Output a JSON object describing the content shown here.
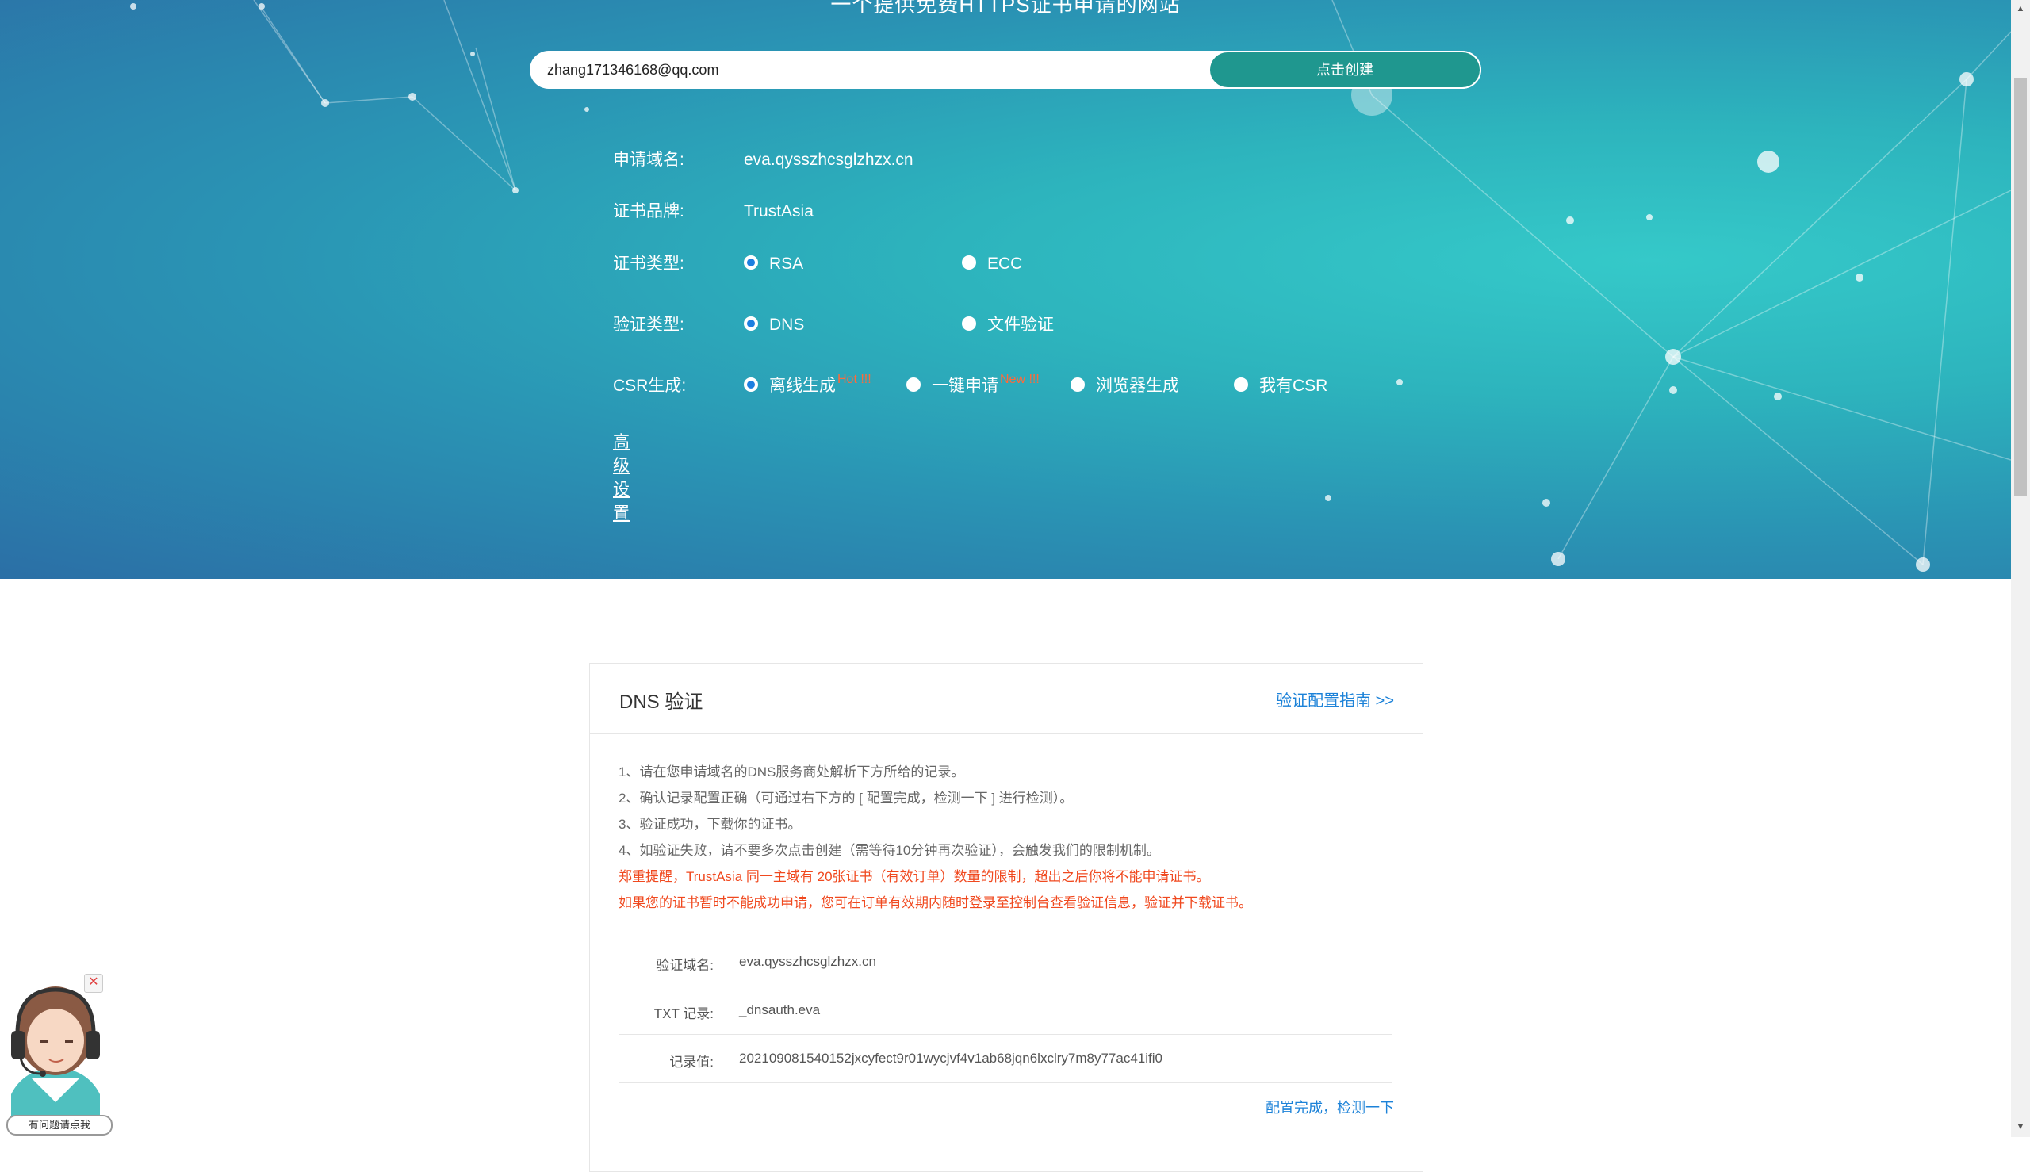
{
  "hero": {
    "title": "一个提供免费HTTPS证书申请的网站",
    "email": "zhang171346168@qq.com",
    "create_label": "点击创建"
  },
  "form": {
    "domain_label": "申请域名:",
    "domain_value": "eva.qysszhcsglzhzx.cn",
    "brand_label": "证书品牌:",
    "brand_value": "TrustAsia",
    "type_label": "证书类型:",
    "type_options": [
      "RSA",
      "ECC"
    ],
    "type_selected": "RSA",
    "verify_label": "验证类型:",
    "verify_options": [
      "DNS",
      "文件验证"
    ],
    "verify_selected": "DNS",
    "csr_label": "CSR生成:",
    "csr_options": [
      {
        "label": "离线生成",
        "badge": "Hot !!!"
      },
      {
        "label": "一键申请",
        "badge": "New !!!"
      },
      {
        "label": "浏览器生成",
        "badge": ""
      },
      {
        "label": "我有CSR",
        "badge": ""
      }
    ],
    "csr_selected": "离线生成",
    "advanced_label": "高级设置"
  },
  "card": {
    "title": "DNS 验证",
    "guide_link": "验证配置指南 >>",
    "steps": [
      "1、请在您申请域名的DNS服务商处解析下方所给的记录。",
      "2、确认记录配置正确（可通过右下方的 [ 配置完成，检测一下 ] 进行检测）。",
      "3、验证成功，下载你的证书。",
      "4、如验证失败，请不要多次点击创建（需等待10分钟再次验证），会触发我们的限制机制。"
    ],
    "warnings": [
      "郑重提醒，TrustAsia 同一主域有 20张证书（有效订单）数量的限制，超出之后你将不能申请证书。",
      "如果您的证书暂时不能成功申请，您可在订单有效期内随时登录至控制台查看验证信息，验证并下载证书。"
    ],
    "records": [
      {
        "key": "验证域名:",
        "value": "eva.qysszhcsglzhzx.cn"
      },
      {
        "key": "TXT 记录:",
        "value": "_dnsauth.eva"
      },
      {
        "key": "记录值:",
        "value": "202109081540152jxcyfect9r01wycjvf4v1ab68jqn6lxclry7m8y77ac41ifi0"
      }
    ],
    "check_link": "配置完成，检测一下"
  },
  "support": {
    "label": "有问题请点我",
    "close_icon": "close-icon"
  },
  "colors": {
    "accent": "#1c82d8",
    "button": "#1f978f",
    "warning": "#f0491f",
    "badge": "#ff6a3a"
  }
}
